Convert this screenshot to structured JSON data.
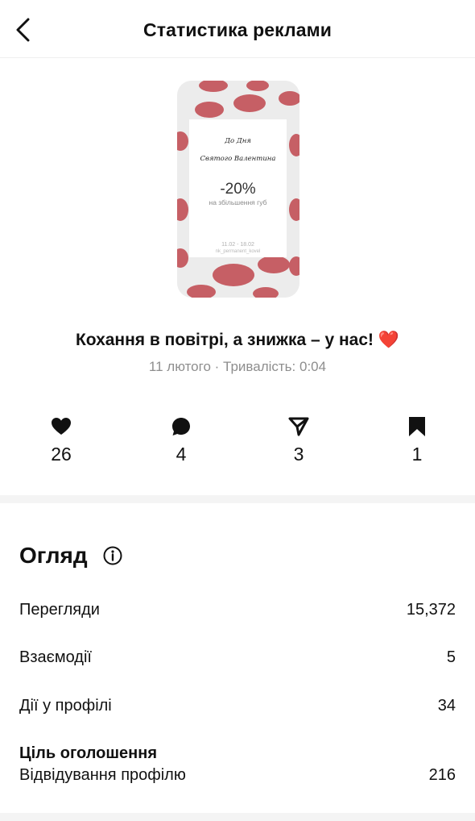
{
  "header": {
    "title": "Статистика реклами",
    "back_icon": "chevron-left-icon"
  },
  "creative": {
    "line1": "До Дня",
    "line2": "Святого Валентина",
    "discount": "-20%",
    "subtitle": "на збільшення губ",
    "dates": "11.02 - 18.02",
    "handle": "nk_permanent_kovel",
    "accent_color": "#c0474e"
  },
  "ad": {
    "title": "Кохання в повітрі, а знижка – у нас!",
    "emoji": "❤️",
    "meta": "11 лютого · Тривалість: 0:04"
  },
  "stats": [
    {
      "icon": "heart-icon",
      "value": "26"
    },
    {
      "icon": "comment-icon",
      "value": "4"
    },
    {
      "icon": "share-icon",
      "value": "3"
    },
    {
      "icon": "bookmark-icon",
      "value": "1"
    }
  ],
  "overview": {
    "title": "Огляд",
    "info_icon": "info-icon",
    "rows": [
      {
        "label": "Перегляди",
        "value": "15,372"
      },
      {
        "label": "Взаємодії",
        "value": "5"
      },
      {
        "label": "Дії у профілі",
        "value": "34"
      }
    ],
    "goal": {
      "heading": "Ціль оголошення",
      "label": "Відвідування профілю",
      "value": "216"
    }
  }
}
